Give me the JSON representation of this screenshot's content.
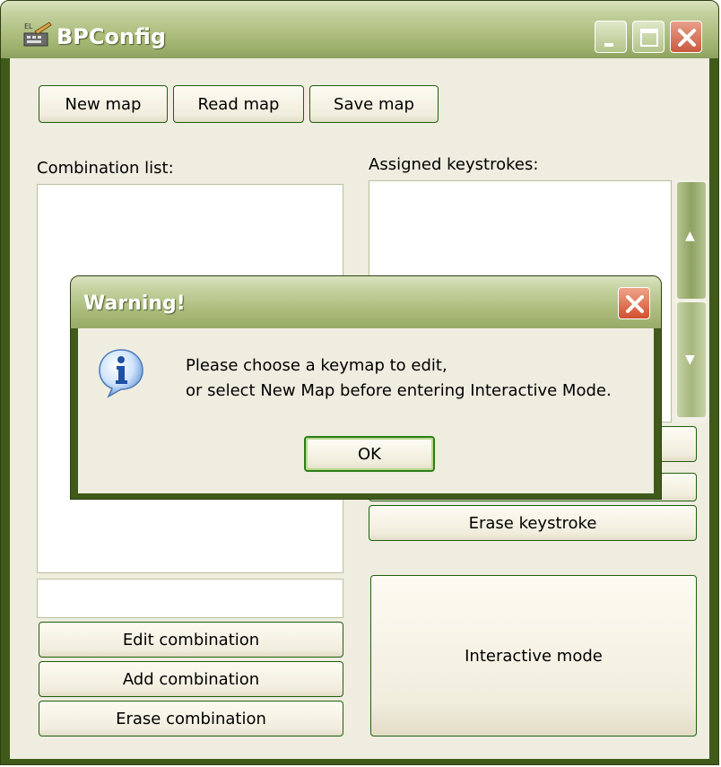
{
  "window": {
    "title": "BPConfig"
  },
  "toolbar": {
    "new_map": "New map",
    "read_map": "Read map",
    "save_map": "Save map"
  },
  "combination": {
    "label": "Combination list:",
    "input_value": "",
    "edit": "Edit combination",
    "add": "Add combination",
    "erase": "Erase combination"
  },
  "keystrokes": {
    "label": "Assigned keystrokes:",
    "hidden_button_1": "",
    "hidden_button_2": "",
    "erase": "Erase keystroke"
  },
  "interactive": {
    "label": "Interactive mode"
  },
  "dialog": {
    "title": "Warning!",
    "message_line1": "Please choose a keymap to edit,",
    "message_line2": "or select New Map before entering Interactive Mode.",
    "ok": "OK",
    "icon": "info-icon"
  },
  "colors": {
    "frame": "#3f5a19",
    "titlebar": "#aebf80",
    "client": "#efece0",
    "button_border": "#1f5f0f"
  }
}
